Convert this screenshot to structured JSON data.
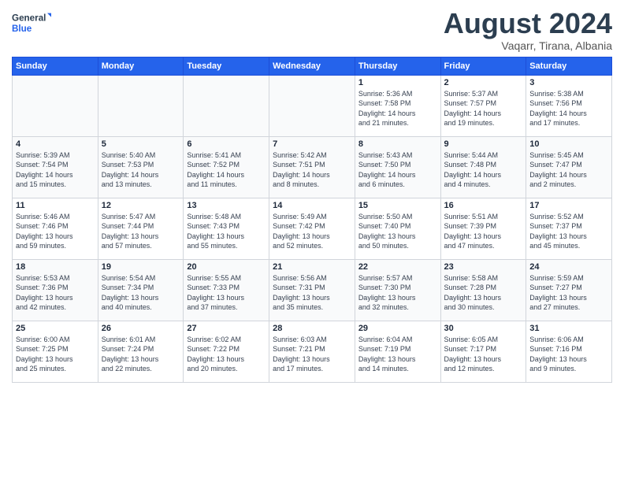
{
  "logo": {
    "text_general": "General",
    "text_blue": "Blue"
  },
  "header": {
    "month_year": "August 2024",
    "location": "Vaqarr, Tirana, Albania"
  },
  "weekdays": [
    "Sunday",
    "Monday",
    "Tuesday",
    "Wednesday",
    "Thursday",
    "Friday",
    "Saturday"
  ],
  "weeks": [
    [
      {
        "day": "",
        "info": ""
      },
      {
        "day": "",
        "info": ""
      },
      {
        "day": "",
        "info": ""
      },
      {
        "day": "",
        "info": ""
      },
      {
        "day": "1",
        "info": "Sunrise: 5:36 AM\nSunset: 7:58 PM\nDaylight: 14 hours\nand 21 minutes."
      },
      {
        "day": "2",
        "info": "Sunrise: 5:37 AM\nSunset: 7:57 PM\nDaylight: 14 hours\nand 19 minutes."
      },
      {
        "day": "3",
        "info": "Sunrise: 5:38 AM\nSunset: 7:56 PM\nDaylight: 14 hours\nand 17 minutes."
      }
    ],
    [
      {
        "day": "4",
        "info": "Sunrise: 5:39 AM\nSunset: 7:54 PM\nDaylight: 14 hours\nand 15 minutes."
      },
      {
        "day": "5",
        "info": "Sunrise: 5:40 AM\nSunset: 7:53 PM\nDaylight: 14 hours\nand 13 minutes."
      },
      {
        "day": "6",
        "info": "Sunrise: 5:41 AM\nSunset: 7:52 PM\nDaylight: 14 hours\nand 11 minutes."
      },
      {
        "day": "7",
        "info": "Sunrise: 5:42 AM\nSunset: 7:51 PM\nDaylight: 14 hours\nand 8 minutes."
      },
      {
        "day": "8",
        "info": "Sunrise: 5:43 AM\nSunset: 7:50 PM\nDaylight: 14 hours\nand 6 minutes."
      },
      {
        "day": "9",
        "info": "Sunrise: 5:44 AM\nSunset: 7:48 PM\nDaylight: 14 hours\nand 4 minutes."
      },
      {
        "day": "10",
        "info": "Sunrise: 5:45 AM\nSunset: 7:47 PM\nDaylight: 14 hours\nand 2 minutes."
      }
    ],
    [
      {
        "day": "11",
        "info": "Sunrise: 5:46 AM\nSunset: 7:46 PM\nDaylight: 13 hours\nand 59 minutes."
      },
      {
        "day": "12",
        "info": "Sunrise: 5:47 AM\nSunset: 7:44 PM\nDaylight: 13 hours\nand 57 minutes."
      },
      {
        "day": "13",
        "info": "Sunrise: 5:48 AM\nSunset: 7:43 PM\nDaylight: 13 hours\nand 55 minutes."
      },
      {
        "day": "14",
        "info": "Sunrise: 5:49 AM\nSunset: 7:42 PM\nDaylight: 13 hours\nand 52 minutes."
      },
      {
        "day": "15",
        "info": "Sunrise: 5:50 AM\nSunset: 7:40 PM\nDaylight: 13 hours\nand 50 minutes."
      },
      {
        "day": "16",
        "info": "Sunrise: 5:51 AM\nSunset: 7:39 PM\nDaylight: 13 hours\nand 47 minutes."
      },
      {
        "day": "17",
        "info": "Sunrise: 5:52 AM\nSunset: 7:37 PM\nDaylight: 13 hours\nand 45 minutes."
      }
    ],
    [
      {
        "day": "18",
        "info": "Sunrise: 5:53 AM\nSunset: 7:36 PM\nDaylight: 13 hours\nand 42 minutes."
      },
      {
        "day": "19",
        "info": "Sunrise: 5:54 AM\nSunset: 7:34 PM\nDaylight: 13 hours\nand 40 minutes."
      },
      {
        "day": "20",
        "info": "Sunrise: 5:55 AM\nSunset: 7:33 PM\nDaylight: 13 hours\nand 37 minutes."
      },
      {
        "day": "21",
        "info": "Sunrise: 5:56 AM\nSunset: 7:31 PM\nDaylight: 13 hours\nand 35 minutes."
      },
      {
        "day": "22",
        "info": "Sunrise: 5:57 AM\nSunset: 7:30 PM\nDaylight: 13 hours\nand 32 minutes."
      },
      {
        "day": "23",
        "info": "Sunrise: 5:58 AM\nSunset: 7:28 PM\nDaylight: 13 hours\nand 30 minutes."
      },
      {
        "day": "24",
        "info": "Sunrise: 5:59 AM\nSunset: 7:27 PM\nDaylight: 13 hours\nand 27 minutes."
      }
    ],
    [
      {
        "day": "25",
        "info": "Sunrise: 6:00 AM\nSunset: 7:25 PM\nDaylight: 13 hours\nand 25 minutes."
      },
      {
        "day": "26",
        "info": "Sunrise: 6:01 AM\nSunset: 7:24 PM\nDaylight: 13 hours\nand 22 minutes."
      },
      {
        "day": "27",
        "info": "Sunrise: 6:02 AM\nSunset: 7:22 PM\nDaylight: 13 hours\nand 20 minutes."
      },
      {
        "day": "28",
        "info": "Sunrise: 6:03 AM\nSunset: 7:21 PM\nDaylight: 13 hours\nand 17 minutes."
      },
      {
        "day": "29",
        "info": "Sunrise: 6:04 AM\nSunset: 7:19 PM\nDaylight: 13 hours\nand 14 minutes."
      },
      {
        "day": "30",
        "info": "Sunrise: 6:05 AM\nSunset: 7:17 PM\nDaylight: 13 hours\nand 12 minutes."
      },
      {
        "day": "31",
        "info": "Sunrise: 6:06 AM\nSunset: 7:16 PM\nDaylight: 13 hours\nand 9 minutes."
      }
    ]
  ]
}
